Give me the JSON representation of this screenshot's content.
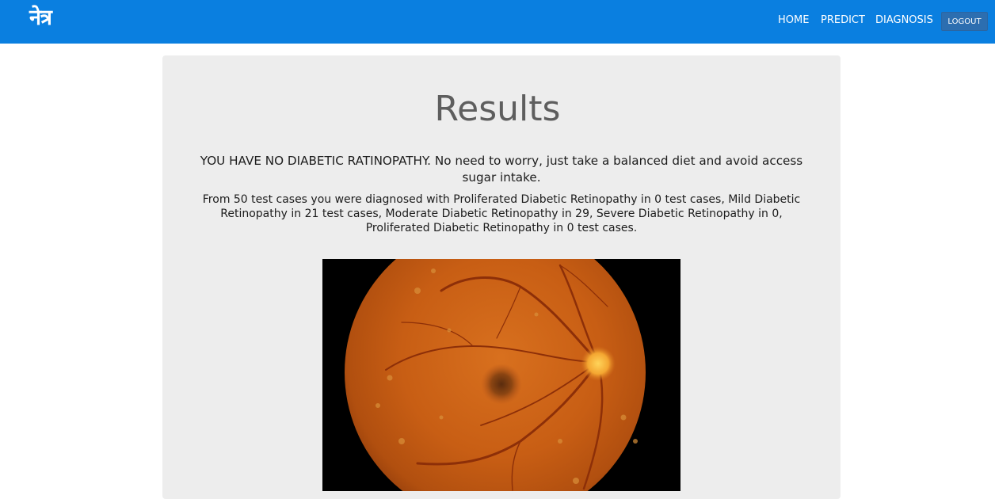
{
  "navbar": {
    "brand": "नेत्र",
    "links": [
      {
        "label": "HOME"
      },
      {
        "label": "PREDICT"
      },
      {
        "label": "DIAGNOSIS"
      }
    ],
    "logout_label": "LOGOUT",
    "background_color": "#0a7fe0"
  },
  "results": {
    "title": "Results",
    "verdict": "YOU HAVE NO DIABETIC RATINOPATHY. No need to worry, just take a balanced diet and avoid access sugar intake.",
    "summary": "From 50 test cases you were diagnosed with Proliferated Diabetic Retinopathy in 0 test cases, Mild Diabetic Retinopathy in 21 test cases, Moderate Diabetic Retinopathy in 29, Severe Diabetic Retinopathy in 0, Proliferated Diabetic Retinopathy in 0 test cases."
  },
  "image": {
    "subject": "retinal-fundus-photograph"
  }
}
